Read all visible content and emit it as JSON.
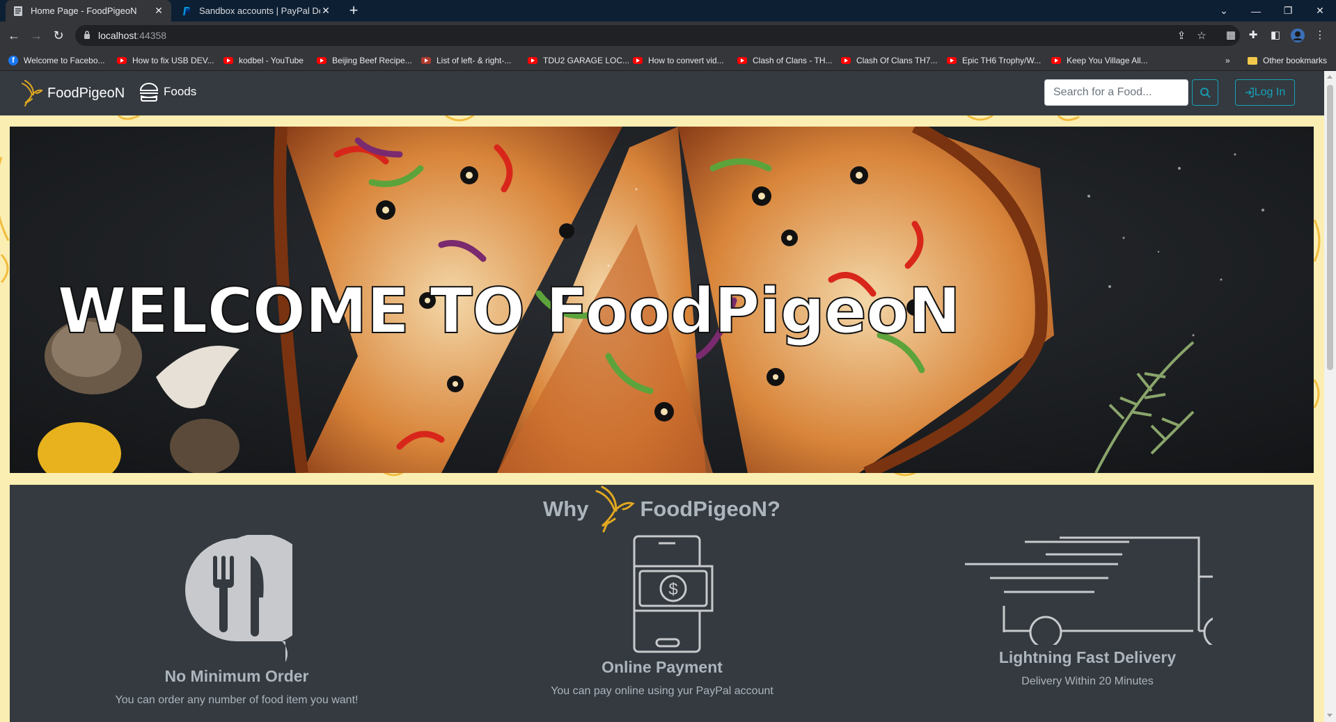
{
  "browser": {
    "tabs": [
      {
        "title": "Home Page - FoodPigeoN",
        "active": true
      },
      {
        "title": "Sandbox accounts | PayPal Developer",
        "active": false
      }
    ],
    "url_host": "localhost",
    "url_port": ":44358",
    "bookmarks": [
      "Welcome to Facebo...",
      "How to fix USB DEV...",
      "kodbel - YouTube",
      "Beijing Beef Recipe...",
      "List of left- & right-...",
      "TDU2 GARAGE LOC...",
      "How to convert vid...",
      "Clash of Clans - TH...",
      "Clash Of Clans TH7...",
      "Epic TH6 Trophy/W...",
      "Keep You Village All..."
    ],
    "other_bookmarks": "Other bookmarks",
    "overflow": "»"
  },
  "navbar": {
    "brand": "FoodPigeoN",
    "foods_link": "Foods",
    "search_placeholder": "Search for a Food...",
    "login": "Log In"
  },
  "hero": {
    "title": "WELCOME TO FoodPigeoN"
  },
  "why": {
    "prefix": "Why",
    "suffix": "FoodPigeoN?",
    "features": [
      {
        "icon": "cutlery-bubble-icon",
        "title": "No Minimum Order",
        "desc": "You can order any number of food item you want!"
      },
      {
        "icon": "phone-payment-icon",
        "title": "Online Payment",
        "desc": "You can pay online using yur PayPal account"
      },
      {
        "icon": "delivery-truck-icon",
        "title": "Lightning Fast Delivery",
        "desc": "Delivery Within 20 Minutes"
      }
    ]
  },
  "colors": {
    "navbar": "#343a40",
    "page_bg": "#fbeeb3",
    "accent": "#17a2b8",
    "brand_gold": "#e2a820"
  }
}
